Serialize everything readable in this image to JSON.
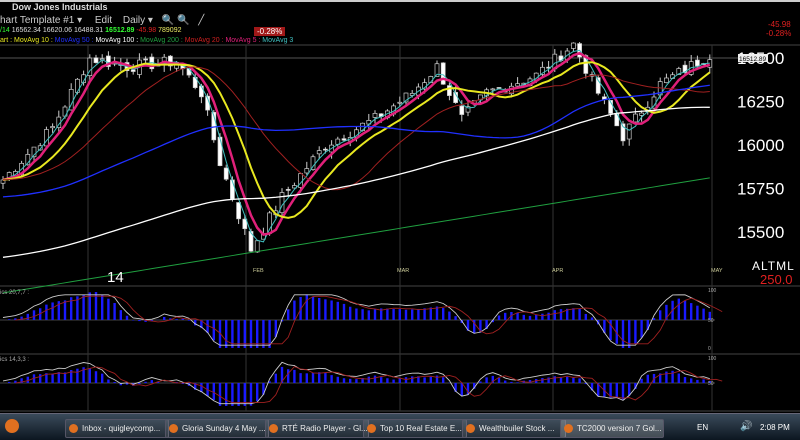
{
  "window": {
    "title": "Dow Jones Industrials"
  },
  "toolbar": {
    "template": "hart Template #1 ▾",
    "edit": "Edit",
    "period": "Daily ▾"
  },
  "quote": {
    "date": "/14",
    "open": "16562.34",
    "high": "16620.06",
    "low": "16488.31",
    "close": "16512.89",
    "change": "-45.98",
    "volume": "789092",
    "pct": "-0.28%"
  },
  "legend": [
    {
      "label": "art : MovAvg 10 :",
      "color": "#e8e820"
    },
    {
      "label": " MovAvg 50 :",
      "color": "#2030ff"
    },
    {
      "label": " MovAvg 100 :",
      "color": "#ffffff"
    },
    {
      "label": " MovAvg 200 :",
      "color": "#20a040"
    },
    {
      "label": " MovAvg 20 :",
      "color": "#d02020"
    },
    {
      "label": " MovAvg 5 :",
      "color": "#e0207a"
    },
    {
      "label": " MovAvg 3",
      "color": "#40c0c0"
    }
  ],
  "top_right": {
    "change": "-45.98",
    "pct": "-0.28%"
  },
  "price_axis": [
    "16500",
    "16250",
    "16000",
    "15750",
    "15500"
  ],
  "last_price_tag": "16512.89",
  "months": [
    "FEB",
    "MAR",
    "APR",
    "MAY"
  ],
  "year_label": "14",
  "altml": {
    "label": "ALTML",
    "value": "250.0"
  },
  "panel2": {
    "label": "ics 20,7,7 :",
    "ticks": [
      "100",
      "50",
      "0"
    ]
  },
  "panel3": {
    "label": "ics 14,3,3 :",
    "ticks": [
      "100",
      "50"
    ]
  },
  "chart_data": {
    "type": "candlestick",
    "ylim": [
      15300,
      16700
    ],
    "price_path": [
      [
        0,
        15800
      ],
      [
        8,
        16100
      ],
      [
        14,
        16500
      ],
      [
        20,
        16450
      ],
      [
        28,
        16480
      ],
      [
        32,
        16300
      ],
      [
        35,
        15900
      ],
      [
        40,
        15400
      ],
      [
        45,
        15700
      ],
      [
        52,
        16000
      ],
      [
        60,
        16150
      ],
      [
        66,
        16300
      ],
      [
        70,
        16450
      ],
      [
        74,
        16150
      ],
      [
        78,
        16300
      ],
      [
        86,
        16400
      ],
      [
        92,
        16580
      ],
      [
        96,
        16300
      ],
      [
        100,
        16050
      ],
      [
        106,
        16350
      ],
      [
        114,
        16520
      ]
    ]
  },
  "taskbar": {
    "items": [
      "Inbox - quigleycomp...",
      "Gloria Sunday 4 May ...",
      "RTÉ Radio Player - Gl...",
      "Top 10 Real Estate E...",
      "Wealthbuiler Stock ...",
      "TC2000 version 7 Gol..."
    ],
    "lang": "EN",
    "time": "2:08 PM"
  }
}
